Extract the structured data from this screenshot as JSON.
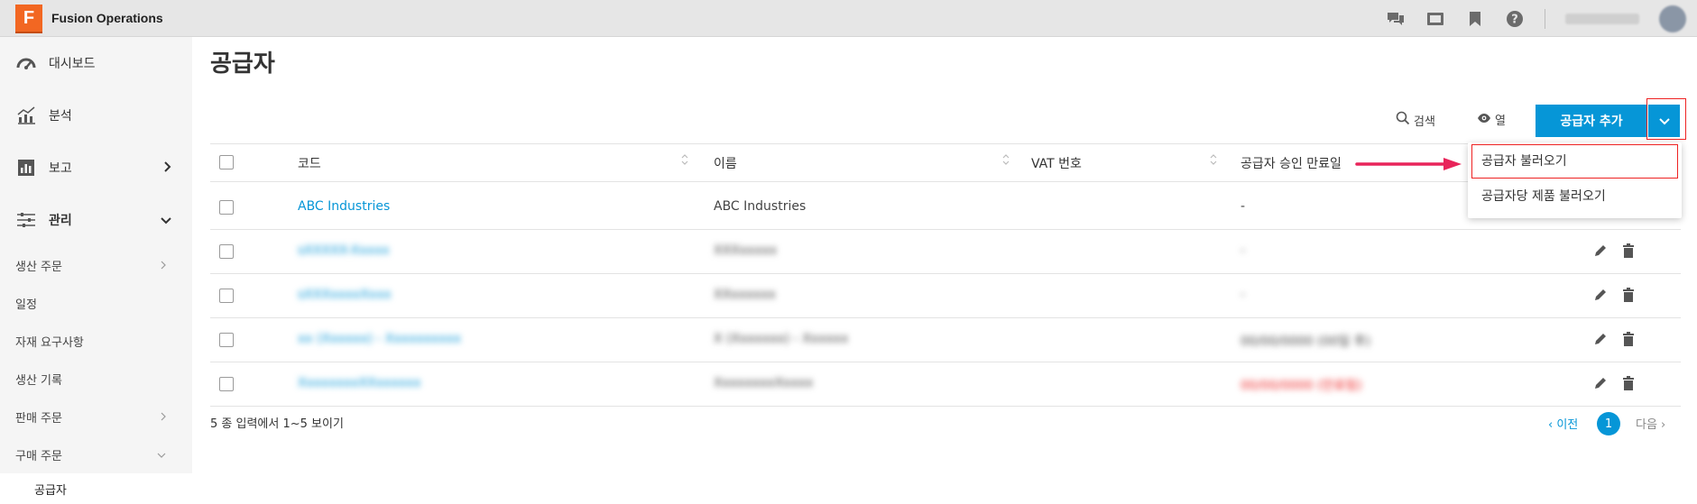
{
  "app": {
    "logo_letter": "F",
    "title": "Fusion Operations"
  },
  "topbar": {
    "user_name": "Workstation"
  },
  "sidebar": {
    "main_items": [
      {
        "label": "대시보드",
        "icon": "dashboard-gauge-icon"
      },
      {
        "label": "분석",
        "icon": "analytics-chart-icon"
      },
      {
        "label": "보고",
        "icon": "report-bars-icon",
        "chevron": "right"
      },
      {
        "label": "관리",
        "icon": "sliders-icon",
        "chevron": "down"
      }
    ],
    "sub_items": [
      {
        "label": "생산 주문",
        "chevron": "right"
      },
      {
        "label": "일정"
      },
      {
        "label": "자재 요구사항"
      },
      {
        "label": "생산 기록"
      },
      {
        "label": "판매 주문",
        "chevron": "right"
      },
      {
        "label": "구매 주문",
        "chevron": "down"
      }
    ],
    "active_item": "공급자"
  },
  "page": {
    "title": "공급자"
  },
  "toolbar": {
    "search_label": "검색",
    "columns_label": "열",
    "add_button_label": "공급자 추가"
  },
  "table": {
    "columns": [
      "코드",
      "이름",
      "VAT 번호",
      "공급자 승인 만료일"
    ],
    "rows": [
      {
        "code": "ABC Industries",
        "name": "ABC Industries",
        "vat": "",
        "expiry": "-",
        "blurred": false
      },
      {
        "code": "sXXXXX-Xxxxx",
        "name": "XXXxxxxx",
        "vat": "",
        "expiry": "-",
        "blurred": true
      },
      {
        "code": "sXXXxxxxXxxx",
        "name": "XXxxxxxx",
        "vat": "",
        "expiry": "-",
        "blurred": true
      },
      {
        "code": "xx (Xxxxxx) - Xxxxxxxxxx",
        "name": "X (Xxxxxxx) - Xxxxxx",
        "vat": "",
        "expiry": "00/00/0000 (00일 후)",
        "blurred": true
      },
      {
        "code": "XxxxxxxxXXxxxxxx",
        "name": "XxxxxxxxXxxxx",
        "vat": "",
        "expiry": "00/00/0000 (만료됨)",
        "blurred": true
      }
    ]
  },
  "dropdown": {
    "items": [
      "공급자 불러오기",
      "공급자당 제품 불러오기"
    ]
  },
  "footer": {
    "summary": "5 종 입력에서 1~5 보이기"
  },
  "pagination": {
    "prev": "‹ 이전",
    "current": "1",
    "next": "다음 ›"
  },
  "colors": {
    "accent": "#0696d7",
    "highlight": "#e22222",
    "arrow": "#e8245a",
    "logo": "#f26722"
  }
}
